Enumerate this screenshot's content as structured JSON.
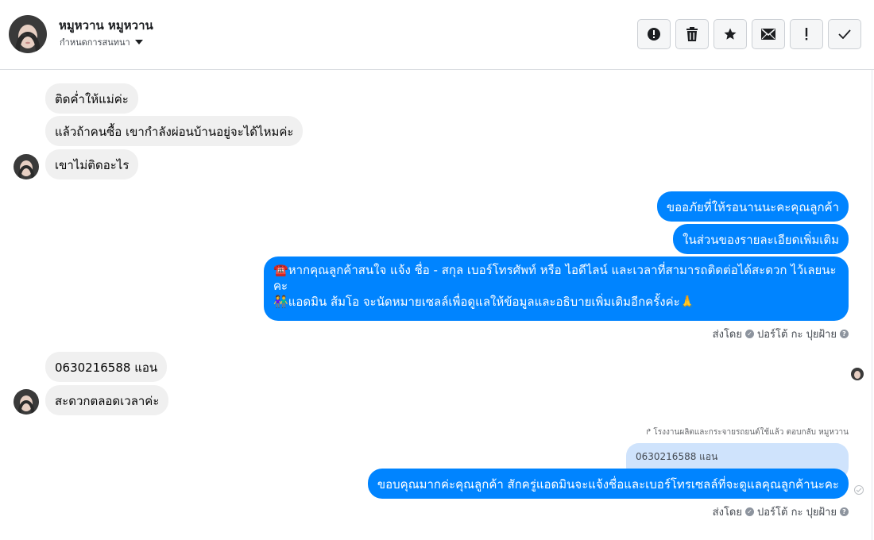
{
  "header": {
    "contact_name": "หมูหวาน หมูหวาน",
    "subtitle": "กำหนดการสนทนา",
    "actions": [
      "alert-circle",
      "trash",
      "star",
      "mail",
      "exclamation",
      "check"
    ]
  },
  "messages": {
    "m1": "ติดค่ำให้แม่ค่ะ",
    "m2": "แล้วถ้าคนซื้อ เขากำลังผ่อนบ้านอยู่จะได้ไหมค่ะ",
    "m3": "เขาไม่ติดอะไร",
    "m4": "ขออภัยที่ให้รอนานนะคะคุณลูกค้า",
    "m5": "ในส่วนของรายละเอียดเพิ่มเติม",
    "m6_line1_icon": "☎️",
    "m6_line1": "หากคุณลูกค้าสนใจ แจ้ง ชื่อ - สกุล เบอร์โทรศัพท์ หรือ ไอดีไลน์ และเวลาที่สามารถติดต่อได้สะดวก ไว้เลยนะคะ",
    "m6_line2_icon": "👫",
    "m6_line2": "แอดมิน ส้มโอ จะนัดหมายเซลล์เพื่อดูแลให้ข้อมูลและอธิบายเพิ่มเติมอีกครั้งค่ะ",
    "m6_line2_end": "🙏",
    "m7": "0630216588 แอน",
    "m8": "สะดวกตลอดเวลาค่ะ",
    "reply_note": "โรงงานผลิตและกระจายรถยนต์ใช้แล้ว ตอบกลับ หมูหวาน",
    "quoted": "0630216588 แอน",
    "m9": "ขอบคุณมากค่ะคุณลูกค้า สักครู่แอดมินจะแจ้งชื่อและเบอร์โทรเซลล์ที่จะดูแลคุณลูกค้านะคะ"
  },
  "sent_by": {
    "label": "ส่งโดย",
    "name": "ปอร์โต้ กะ ปุยฝ้าย",
    "help": "?"
  },
  "colors": {
    "outgoing": "#0084ff",
    "incoming": "#f0f0f0",
    "quote": "#cfe3fc"
  }
}
